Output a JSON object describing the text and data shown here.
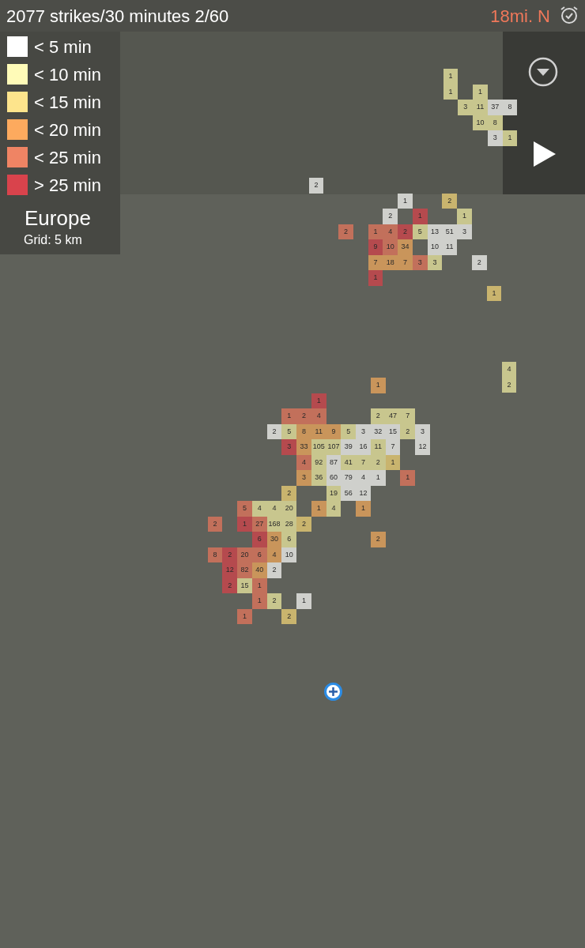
{
  "status": {
    "strikes": "2077 strikes/30 minutes 2/60",
    "distance": "18mi. N"
  },
  "legend": {
    "items": [
      {
        "label": "< 5 min",
        "color": "#ffffff"
      },
      {
        "label": "< 10 min",
        "color": "#fffbb8"
      },
      {
        "label": "< 15 min",
        "color": "#fde48c"
      },
      {
        "label": "< 20 min",
        "color": "#fdaa5e"
      },
      {
        "label": "< 25 min",
        "color": "#ef8464"
      },
      {
        "label": "> 25 min",
        "color": "#d9434c"
      }
    ],
    "region": "Europe",
    "grid": "Grid: 5 km"
  },
  "clusters": [
    {
      "rows": [
        [
          {
            "count": "1",
            "color": "#c8c68e"
          }
        ],
        [
          {
            "count": "1",
            "color": "#c8c68e"
          },
          null,
          {
            "count": "1",
            "color": "#c8c68e"
          }
        ],
        [
          null,
          {
            "count": "3",
            "color": "#c8c68e"
          },
          {
            "count": "11",
            "color": "#c8c68e"
          },
          {
            "count": "37",
            "color": "#cfd0cc"
          },
          {
            "count": "8",
            "color": "#cfd0cc"
          }
        ],
        [
          null,
          null,
          {
            "count": "10",
            "color": "#c8c68e"
          },
          {
            "count": "8",
            "color": "#c8c68e"
          }
        ],
        [
          null,
          null,
          null,
          {
            "count": "3",
            "color": "#cfd0cc"
          },
          {
            "count": "1",
            "color": "#c8c68e"
          }
        ]
      ]
    },
    {
      "rows": [
        [
          {
            "count": "2",
            "color": "#cfd0cc"
          }
        ],
        [
          null,
          null,
          null,
          null,
          null,
          null,
          {
            "count": "1",
            "color": "#cfd0cc"
          },
          null,
          null,
          {
            "count": "2",
            "color": "#c9b46e"
          }
        ],
        [
          null,
          null,
          null,
          null,
          null,
          {
            "count": "2",
            "color": "#cfd0cc"
          },
          null,
          {
            "count": "1",
            "color": "#b54a4e"
          },
          null,
          null,
          {
            "count": "1",
            "color": "#c8c68e"
          }
        ],
        [
          null,
          null,
          {
            "count": "2",
            "color": "#c2705b"
          },
          null,
          {
            "count": "1",
            "color": "#c2705b"
          },
          {
            "count": "4",
            "color": "#c2705b"
          },
          {
            "count": "2",
            "color": "#b54a4e"
          },
          {
            "count": "5",
            "color": "#c8c68e"
          },
          {
            "count": "13",
            "color": "#cfd0cc"
          },
          {
            "count": "51",
            "color": "#cfd0cc"
          },
          {
            "count": "3",
            "color": "#cfd0cc"
          }
        ],
        [
          null,
          null,
          null,
          null,
          {
            "count": "9",
            "color": "#b54a4e"
          },
          {
            "count": "10",
            "color": "#c2705b"
          },
          {
            "count": "34",
            "color": "#c9955b"
          },
          null,
          {
            "count": "10",
            "color": "#cfd0cc"
          },
          {
            "count": "11",
            "color": "#cfd0cc"
          }
        ],
        [
          null,
          null,
          null,
          null,
          {
            "count": "7",
            "color": "#c9955b"
          },
          {
            "count": "18",
            "color": "#c9955b"
          },
          {
            "count": "7",
            "color": "#c9955b"
          },
          {
            "count": "3",
            "color": "#c2705b"
          },
          {
            "count": "3",
            "color": "#c8c68e"
          },
          null,
          null,
          {
            "count": "2",
            "color": "#cfd0cc"
          }
        ],
        [
          null,
          null,
          null,
          null,
          {
            "count": "1",
            "color": "#b54a4e"
          }
        ],
        [
          null,
          null,
          null,
          null,
          null,
          null,
          null,
          null,
          null,
          null,
          null,
          null,
          {
            "count": "1",
            "color": "#c9b46e"
          }
        ]
      ]
    },
    {
      "rows": [
        [
          null,
          null,
          null,
          null,
          null,
          null,
          null,
          null,
          null,
          null,
          null,
          {
            "count": "1",
            "color": "#c9955b"
          }
        ],
        [
          null,
          null,
          null,
          null,
          null,
          null,
          null,
          {
            "count": "1",
            "color": "#b54a4e"
          }
        ],
        [
          null,
          null,
          null,
          null,
          null,
          {
            "count": "1",
            "color": "#c2705b"
          },
          {
            "count": "2",
            "color": "#c2705b"
          },
          {
            "count": "4",
            "color": "#c2705b"
          },
          null,
          null,
          null,
          {
            "count": "2",
            "color": "#c8c68e"
          },
          {
            "count": "47",
            "color": "#c8c68e"
          },
          {
            "count": "7",
            "color": "#c8c68e"
          }
        ],
        [
          null,
          null,
          null,
          null,
          {
            "count": "2",
            "color": "#cfd0cc"
          },
          {
            "count": "5",
            "color": "#c8c68e"
          },
          {
            "count": "8",
            "color": "#c9955b"
          },
          {
            "count": "11",
            "color": "#c9955b"
          },
          {
            "count": "9",
            "color": "#c9955b"
          },
          {
            "count": "5",
            "color": "#c8c68e"
          },
          {
            "count": "3",
            "color": "#cfd0cc"
          },
          {
            "count": "32",
            "color": "#cfd0cc"
          },
          {
            "count": "15",
            "color": "#cfd0cc"
          },
          {
            "count": "2",
            "color": "#c8c68e"
          },
          {
            "count": "3",
            "color": "#cfd0cc"
          }
        ],
        [
          null,
          null,
          null,
          null,
          null,
          {
            "count": "3",
            "color": "#b54a4e"
          },
          {
            "count": "33",
            "color": "#c9955b"
          },
          {
            "count": "105",
            "color": "#c8c68e"
          },
          {
            "count": "107",
            "color": "#c8c68e"
          },
          {
            "count": "39",
            "color": "#cfd0cc"
          },
          {
            "count": "16",
            "color": "#cfd0cc"
          },
          {
            "count": "11",
            "color": "#c8c68e"
          },
          {
            "count": "7",
            "color": "#cfd0cc"
          },
          null,
          {
            "count": "12",
            "color": "#cfd0cc"
          }
        ],
        [
          null,
          null,
          null,
          null,
          null,
          null,
          {
            "count": "4",
            "color": "#c2705b"
          },
          {
            "count": "92",
            "color": "#c8c68e"
          },
          {
            "count": "87",
            "color": "#cfd0cc"
          },
          {
            "count": "41",
            "color": "#c8c68e"
          },
          {
            "count": "7",
            "color": "#c8c68e"
          },
          {
            "count": "2",
            "color": "#c8c68e"
          },
          {
            "count": "1",
            "color": "#c9b46e"
          }
        ],
        [
          null,
          null,
          null,
          null,
          null,
          null,
          {
            "count": "3",
            "color": "#c9955b"
          },
          {
            "count": "36",
            "color": "#c8c68e"
          },
          {
            "count": "60",
            "color": "#cfd0cc"
          },
          {
            "count": "79",
            "color": "#cfd0cc"
          },
          {
            "count": "4",
            "color": "#cfd0cc"
          },
          {
            "count": "1",
            "color": "#cfd0cc"
          },
          null,
          {
            "count": "1",
            "color": "#c2705b"
          }
        ],
        [
          null,
          null,
          null,
          null,
          null,
          {
            "count": "2",
            "color": "#c9b46e"
          },
          null,
          null,
          {
            "count": "19",
            "color": "#c8c68e"
          },
          {
            "count": "56",
            "color": "#cfd0cc"
          },
          {
            "count": "12",
            "color": "#cfd0cc"
          }
        ],
        [
          null,
          null,
          {
            "count": "5",
            "color": "#c2705b"
          },
          {
            "count": "4",
            "color": "#c8c68e"
          },
          {
            "count": "4",
            "color": "#c8c68e"
          },
          {
            "count": "20",
            "color": "#c8c68e"
          },
          null,
          {
            "count": "1",
            "color": "#c9955b"
          },
          {
            "count": "4",
            "color": "#c8c68e"
          },
          null,
          {
            "count": "1",
            "color": "#c9955b"
          }
        ],
        [
          {
            "count": "2",
            "color": "#c2705b"
          },
          null,
          {
            "count": "1",
            "color": "#b54a4e"
          },
          {
            "count": "27",
            "color": "#c2705b"
          },
          {
            "count": "168",
            "color": "#c8c68e"
          },
          {
            "count": "28",
            "color": "#c8c68e"
          },
          {
            "count": "2",
            "color": "#c9b46e"
          }
        ],
        [
          null,
          null,
          null,
          {
            "count": "6",
            "color": "#b54a4e"
          },
          {
            "count": "30",
            "color": "#c9955b"
          },
          {
            "count": "6",
            "color": "#c8c68e"
          },
          null,
          null,
          null,
          null,
          null,
          {
            "count": "2",
            "color": "#c9955b"
          }
        ],
        [
          {
            "count": "8",
            "color": "#c2705b"
          },
          {
            "count": "2",
            "color": "#b54a4e"
          },
          {
            "count": "20",
            "color": "#c2705b"
          },
          {
            "count": "6",
            "color": "#c2705b"
          },
          {
            "count": "4",
            "color": "#c9955b"
          },
          {
            "count": "10",
            "color": "#cfd0cc"
          }
        ],
        [
          null,
          {
            "count": "12",
            "color": "#b54a4e"
          },
          {
            "count": "82",
            "color": "#c2705b"
          },
          {
            "count": "40",
            "color": "#c9955b"
          },
          {
            "count": "2",
            "color": "#cfd0cc"
          }
        ],
        [
          null,
          {
            "count": "2",
            "color": "#b54a4e"
          },
          {
            "count": "15",
            "color": "#c8c68e"
          },
          {
            "count": "1",
            "color": "#c2705b"
          }
        ],
        [
          null,
          null,
          null,
          {
            "count": "1",
            "color": "#c2705b"
          },
          {
            "count": "2",
            "color": "#c8c68e"
          },
          null,
          {
            "count": "1",
            "color": "#cfd0cc"
          }
        ],
        [
          null,
          null,
          {
            "count": "1",
            "color": "#c2705b"
          },
          null,
          null,
          {
            "count": "2",
            "color": "#c9b46e"
          }
        ]
      ]
    },
    {
      "rows": [
        [
          {
            "count": "4",
            "color": "#c8c68e"
          }
        ],
        [
          {
            "count": "2",
            "color": "#c8c68e"
          }
        ]
      ]
    }
  ]
}
